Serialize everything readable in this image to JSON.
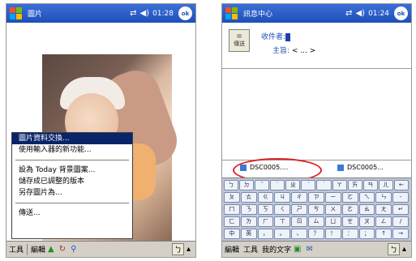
{
  "left": {
    "title": "圖片",
    "clock": "01:28",
    "ok_label": "ok",
    "menu": [
      {
        "label": "圖片資料交換...",
        "selected": true
      },
      {
        "label": "使用輸入器的新功能...",
        "selected": false
      },
      {
        "separator": true
      },
      {
        "label": "設為 Today 背景圖案...",
        "selected": false
      },
      {
        "label": "儲存成已調整的版本",
        "selected": false
      },
      {
        "label": "另存圖片為...",
        "selected": false
      },
      {
        "separator": true
      },
      {
        "label": "傳送...",
        "selected": false
      }
    ],
    "toolbar": {
      "tools": "工具",
      "edit": "編輯",
      "kbd": "ㄅ"
    }
  },
  "right": {
    "title": "訊息中心",
    "clock": "01:24",
    "ok_label": "ok",
    "send_label": "傳送",
    "to_label": "收件者:",
    "to_value": "     ",
    "subject_label": "主旨:",
    "subject_value": "< ... >",
    "attachments": [
      "DSC0005....",
      "DSC0005..."
    ],
    "toolbar": {
      "menu": "編輯",
      "tools": "工具",
      "my_text": "我的文字",
      "kbd": "ㄅ"
    }
  },
  "keyboard_rows": [
    [
      "ㄅ",
      "ㄉ",
      "ˇ",
      "ˋ",
      "ㄓ",
      "ˊ",
      "˙",
      "ㄚ",
      "ㄞ",
      "ㄢ",
      "ㄦ",
      "←"
    ],
    [
      "ㄆ",
      "ㄊ",
      "ㄍ",
      "ㄐ",
      "ㄔ",
      "ㄗ",
      "ㄧ",
      "ㄛ",
      "ㄟ",
      "ㄣ",
      "-"
    ],
    [
      "ㄇ",
      "ㄋ",
      "ㄎ",
      "ㄑ",
      "ㄕ",
      "ㄘ",
      "ㄨ",
      "ㄜ",
      "ㄠ",
      "ㄤ",
      "↵"
    ],
    [
      "ㄈ",
      "ㄌ",
      "ㄏ",
      "ㄒ",
      "ㄖ",
      "ㄙ",
      "ㄩ",
      "ㄝ",
      "ㄡ",
      "ㄥ",
      "/"
    ],
    [
      "中",
      "英",
      "，",
      "。",
      "、",
      "？",
      "！",
      "：",
      "；",
      "↑",
      "→"
    ]
  ],
  "colors": {
    "titlebar": "#1f4fb8",
    "menu_selected": "#0a246a",
    "annotation": "#e02020"
  }
}
